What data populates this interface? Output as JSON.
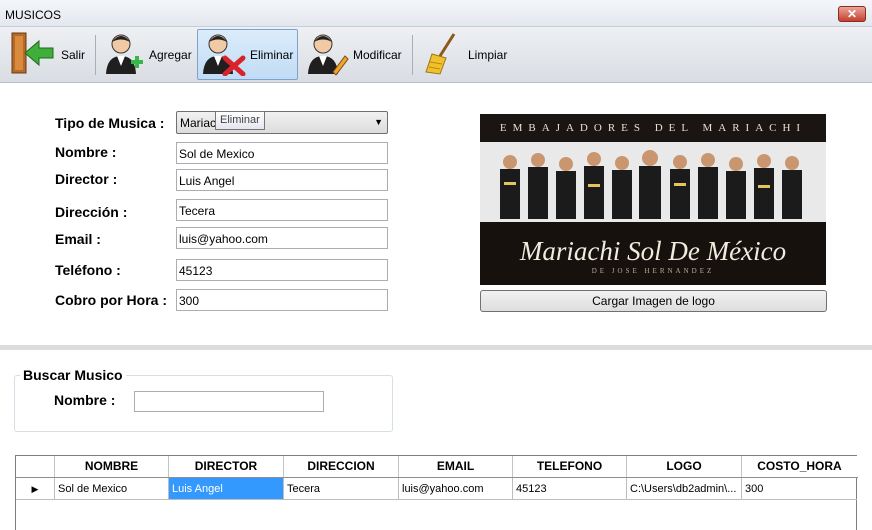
{
  "window": {
    "title": "MUSICOS",
    "close_glyph": "✕"
  },
  "toolbar": {
    "buttons": [
      {
        "label": "Salir",
        "icon": "exit-door-icon"
      },
      {
        "label": "Agregar",
        "icon": "add-user-icon"
      },
      {
        "label": "Eliminar",
        "icon": "delete-user-icon"
      },
      {
        "label": "Modificar",
        "icon": "edit-user-icon"
      },
      {
        "label": "Limpiar",
        "icon": "broom-icon"
      }
    ],
    "active": "Eliminar",
    "tooltip": "Eliminar"
  },
  "form": {
    "tipo_label": "Tipo de Musica :",
    "tipo_value": "Mariachi",
    "nombre_label": "Nombre :",
    "nombre_value": "Sol de Mexico",
    "director_label": "Director :",
    "director_value": "Luis Angel",
    "direccion_label": "Dirección :",
    "direccion_value": "Tecera",
    "email_label": "Email :",
    "email_value": "luis@yahoo.com",
    "telefono_label": "Teléfono :",
    "telefono_value": "45123",
    "cobro_label": "Cobro por Hora :",
    "cobro_value": "300"
  },
  "logo": {
    "top_text": "EMBAJADORES DEL MARIACHI",
    "script_text": "Mariachi Sol De México",
    "sub_text": "DE JOSE HERNANDEZ",
    "load_button": "Cargar Imagen de logo"
  },
  "search": {
    "group_title": "Buscar Musico",
    "nombre_label": "Nombre :",
    "nombre_value": ""
  },
  "grid": {
    "columns": [
      "NOMBRE",
      "DIRECTOR",
      "DIRECCION",
      "EMAIL",
      "TELEFONO",
      "LOGO",
      "COSTO_HORA"
    ],
    "rows": [
      [
        "Sol de Mexico",
        "Luis Angel",
        "Tecera",
        "luis@yahoo.com",
        "45123",
        "C:\\Users\\db2admin\\...",
        "300"
      ]
    ],
    "row_indicator": "▶"
  },
  "colors": {
    "selection": "#3399ff",
    "close_button": "#c5402c"
  }
}
